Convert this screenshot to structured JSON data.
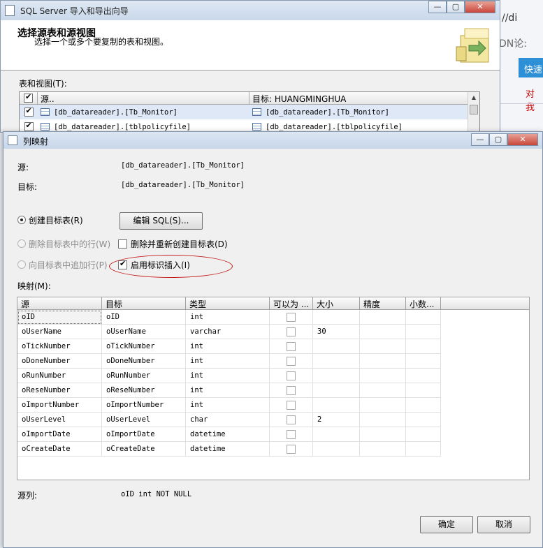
{
  "browser": {
    "url_fragment": "//di",
    "text_fragment": "DN论:",
    "button_fragment": "快速",
    "link_fragment": "对我"
  },
  "wizard": {
    "title": "SQL Server 导入和导出向导",
    "heading": "选择源表和源视图",
    "subheading": "选择一个或多个要复制的表和视图。",
    "tables_label": "表和视图(T):",
    "grid_headers": {
      "source": "源..",
      "destination": "目标: HUANGMINGHUA"
    },
    "rows": [
      {
        "checked": true,
        "source": "[db_datareader].[Tb_Monitor]",
        "destination": "[db_datareader].[Tb_Monitor]"
      },
      {
        "checked": true,
        "source": "[db_datareader].[tblpolicyfile]",
        "destination": "[db_datareader].[tblpolicyfile]"
      }
    ]
  },
  "dialog": {
    "title": "列映射",
    "source_label": "源:",
    "source_value": "[db_datareader].[Tb_Monitor]",
    "target_label": "目标:",
    "target_value": "[db_datareader].[Tb_Monitor]",
    "options": {
      "create_table": "创建目标表(R)",
      "edit_sql": "编辑 SQL(S)...",
      "delete_rows": "删除目标表中的行(W)",
      "drop_recreate": "删除并重新创建目标表(D)",
      "append_rows": "向目标表中追加行(P)",
      "enable_identity": "启用标识插入(I)"
    },
    "state": {
      "selected_option": "create_table",
      "drop_recreate_checked": false,
      "enable_identity_checked": true
    },
    "mapping_label": "映射(M):",
    "columns": [
      "源",
      "目标",
      "类型",
      "可以为 ...",
      "大小",
      "精度",
      "小数..."
    ],
    "rows": [
      {
        "source": "oID",
        "target": "oID",
        "type": "int",
        "nullable": false,
        "size": "",
        "precision": "",
        "scale": ""
      },
      {
        "source": "oUserName",
        "target": "oUserName",
        "type": "varchar",
        "nullable": false,
        "size": "30",
        "precision": "",
        "scale": ""
      },
      {
        "source": "oTickNumber",
        "target": "oTickNumber",
        "type": "int",
        "nullable": false,
        "size": "",
        "precision": "",
        "scale": ""
      },
      {
        "source": "oDoneNumber",
        "target": "oDoneNumber",
        "type": "int",
        "nullable": false,
        "size": "",
        "precision": "",
        "scale": ""
      },
      {
        "source": "oRunNumber",
        "target": "oRunNumber",
        "type": "int",
        "nullable": false,
        "size": "",
        "precision": "",
        "scale": ""
      },
      {
        "source": "oReseNumber",
        "target": "oReseNumber",
        "type": "int",
        "nullable": false,
        "size": "",
        "precision": "",
        "scale": ""
      },
      {
        "source": "oImportNumber",
        "target": "oImportNumber",
        "type": "int",
        "nullable": false,
        "size": "",
        "precision": "",
        "scale": ""
      },
      {
        "source": "oUserLevel",
        "target": "oUserLevel",
        "type": "char",
        "nullable": false,
        "size": "2",
        "precision": "",
        "scale": ""
      },
      {
        "source": "oImportDate",
        "target": "oImportDate",
        "type": "datetime",
        "nullable": false,
        "size": "",
        "precision": "",
        "scale": ""
      },
      {
        "source": "oCreateDate",
        "target": "oCreateDate",
        "type": "datetime",
        "nullable": false,
        "size": "",
        "precision": "",
        "scale": ""
      }
    ],
    "source_column_label": "源列:",
    "source_column_value": "oID int NOT NULL",
    "ok": "确定",
    "cancel": "取消"
  },
  "colors": {
    "accent": "#2d8fd5",
    "highlight_ellipse": "#c41a1a"
  },
  "icons": {
    "window": "form-icon",
    "table": "table-icon",
    "wizard_graphic": "folder-arrow-icon"
  }
}
